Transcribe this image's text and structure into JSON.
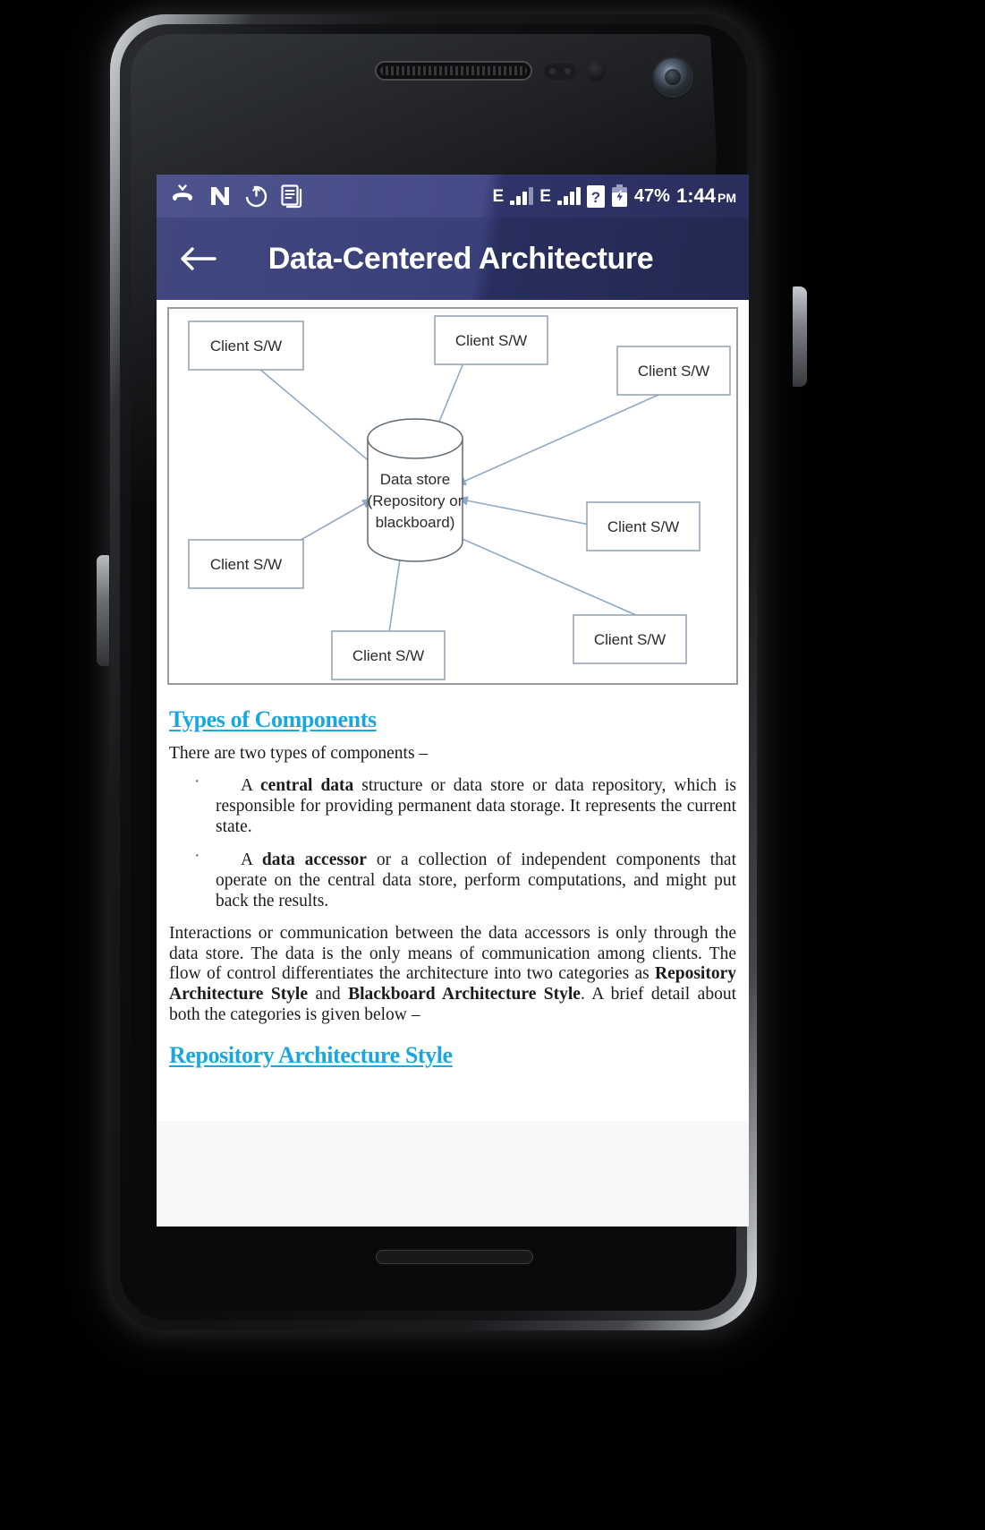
{
  "status_bar": {
    "icons": [
      "missed-call-icon",
      "nextradio-n-icon",
      "power-update-icon",
      "document-icon"
    ],
    "network_label_1": "E",
    "network_label_2": "E",
    "sim_unknown_icon": "?",
    "battery_percent": "47%",
    "time": "1:44",
    "am_pm": "PM"
  },
  "action_bar": {
    "back_icon": "arrow-left-icon",
    "title": "Data-Centered Architecture"
  },
  "figure": {
    "center_label_line1": "Data store",
    "center_label_line2": "(Repository or",
    "center_label_line3": "blackboard)",
    "client_label": "Client S/W",
    "clients": [
      {
        "id": "client-top-left",
        "label": "Client S/W"
      },
      {
        "id": "client-top-center",
        "label": "Client S/W"
      },
      {
        "id": "client-top-right",
        "label": "Client S/W"
      },
      {
        "id": "client-mid-left",
        "label": "Client S/W"
      },
      {
        "id": "client-mid-right",
        "label": "Client S/W"
      },
      {
        "id": "client-bottom-right",
        "label": "Client S/W"
      },
      {
        "id": "client-bottom-left",
        "label": "Client S/W"
      }
    ]
  },
  "article": {
    "heading_1": "Types of Components",
    "intro": "There are two types of components –",
    "bullets": [
      {
        "lead": "A ",
        "bold": "central data",
        "rest": " structure or data store or data repository, which is responsible for providing permanent data storage. It represents the current state."
      },
      {
        "lead": "A ",
        "bold": "data accessor",
        "rest": " or a collection of independent components that operate on the central data store, perform computations, and might put back the results."
      }
    ],
    "paragraph_part1": "Interactions or communication between the data accessors is only through the data store. The data is the only means of communication among clients. The flow of control differentiates the architecture into two categories as ",
    "paragraph_bold1": "Repository Architecture Style",
    "paragraph_part2": " and ",
    "paragraph_bold2": "Blackboard Architecture Style",
    "paragraph_part3": ". A brief detail about both the categories is given below –",
    "heading_2": "Repository Architecture Style"
  },
  "colors": {
    "status_bar_bg": "#3a4080",
    "action_bar_bg": "#333a75",
    "heading_link": "#1aa7e0",
    "diagram_stroke": "#7b96b8",
    "body_text": "#1b1b1b"
  }
}
